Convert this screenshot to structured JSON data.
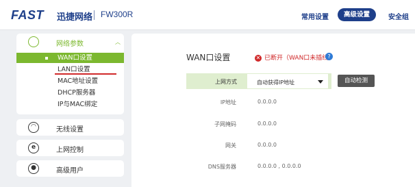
{
  "header": {
    "logo": "FAST",
    "brand_cn": "迅捷网络",
    "model": "FW300R",
    "nav": {
      "common": "常用设置",
      "advanced": "高级设置",
      "security": "安全组"
    }
  },
  "sidebar": {
    "net_params": {
      "label": "网络参数",
      "items": [
        "WAN口设置",
        "LAN口设置",
        "MAC地址设置",
        "DHCP服务器",
        "IP与MAC绑定"
      ]
    },
    "wireless": "无线设置",
    "access_control": "上网控制",
    "advanced_users": "高级用户"
  },
  "main": {
    "title": "WAN口设置",
    "status": "已断开（WAN口未插线）",
    "connection": {
      "label": "上网方式",
      "value": "自动获得IP地址",
      "detect_button": "自动检测"
    },
    "fields": [
      {
        "label": "IP地址",
        "value": "0.0.0.0"
      },
      {
        "label": "子网掩码",
        "value": "0.0.0.0"
      },
      {
        "label": "网关",
        "value": "0.0.0.0"
      },
      {
        "label": "DNS服务器",
        "value": "0.0.0.0 , 0.0.0.0"
      }
    ]
  },
  "colors": {
    "brand": "#1e3f8a",
    "accent": "#7cb82f",
    "error": "#d0292a",
    "help": "#2f7bd6"
  }
}
